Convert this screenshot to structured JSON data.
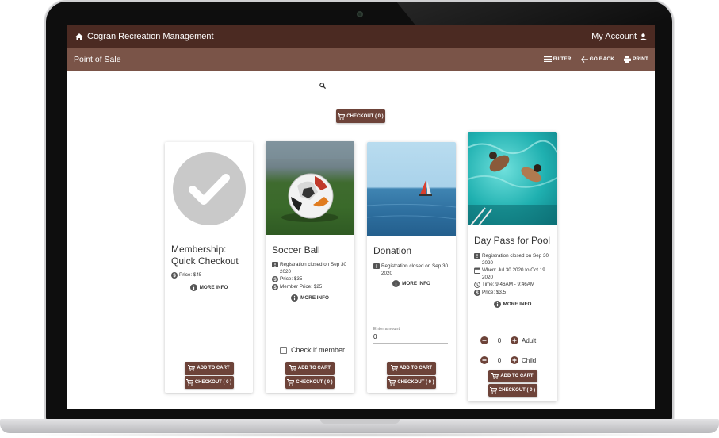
{
  "app": {
    "title": "Cogran Recreation Management",
    "account_label": "My Account"
  },
  "subbar": {
    "title": "Point of Sale",
    "filter_label": "FILTER",
    "go_back_label": "GO BACK",
    "print_label": "PRINT"
  },
  "search": {
    "placeholder": ""
  },
  "top_checkout_label": "CHECKOUT ( 0 )",
  "products": [
    {
      "title": "Membership: Quick Checkout",
      "price": "Price: $45",
      "more_info": "MORE INFO",
      "add_to_cart": "ADD TO CART",
      "checkout": "CHECKOUT ( 0 )"
    },
    {
      "title": "Soccer Ball",
      "registration": "Registration closed on Sep 30 2020",
      "price": "Price: $35",
      "member_price": "Member Price: $25",
      "more_info": "MORE INFO",
      "member_check": "Check if member",
      "add_to_cart": "ADD TO CART",
      "checkout": "CHECKOUT ( 0 )"
    },
    {
      "title": "Donation",
      "registration": "Registration closed on Sep 30 2020",
      "more_info": "MORE INFO",
      "amount_label": "Enter amount",
      "amount_value": "0",
      "add_to_cart": "ADD TO CART",
      "checkout": "CHECKOUT ( 0 )"
    },
    {
      "title": "Day Pass for Pool",
      "registration": "Registration closed on Sep 30 2020",
      "when": "When: Jul 30 2020 to Oct 19 2020",
      "time": "Time: 9:46AM - 9:46AM",
      "price": "Price: $3.5",
      "more_info": "MORE INFO",
      "adult_qty": "0",
      "adult_label": "Adult",
      "child_qty": "0",
      "child_label": "Child",
      "add_to_cart": "ADD TO CART",
      "checkout": "CHECKOUT ( 0 )"
    }
  ],
  "colors": {
    "header": "#4b2a22",
    "subheader": "#7a5448",
    "button": "#6d4339"
  }
}
